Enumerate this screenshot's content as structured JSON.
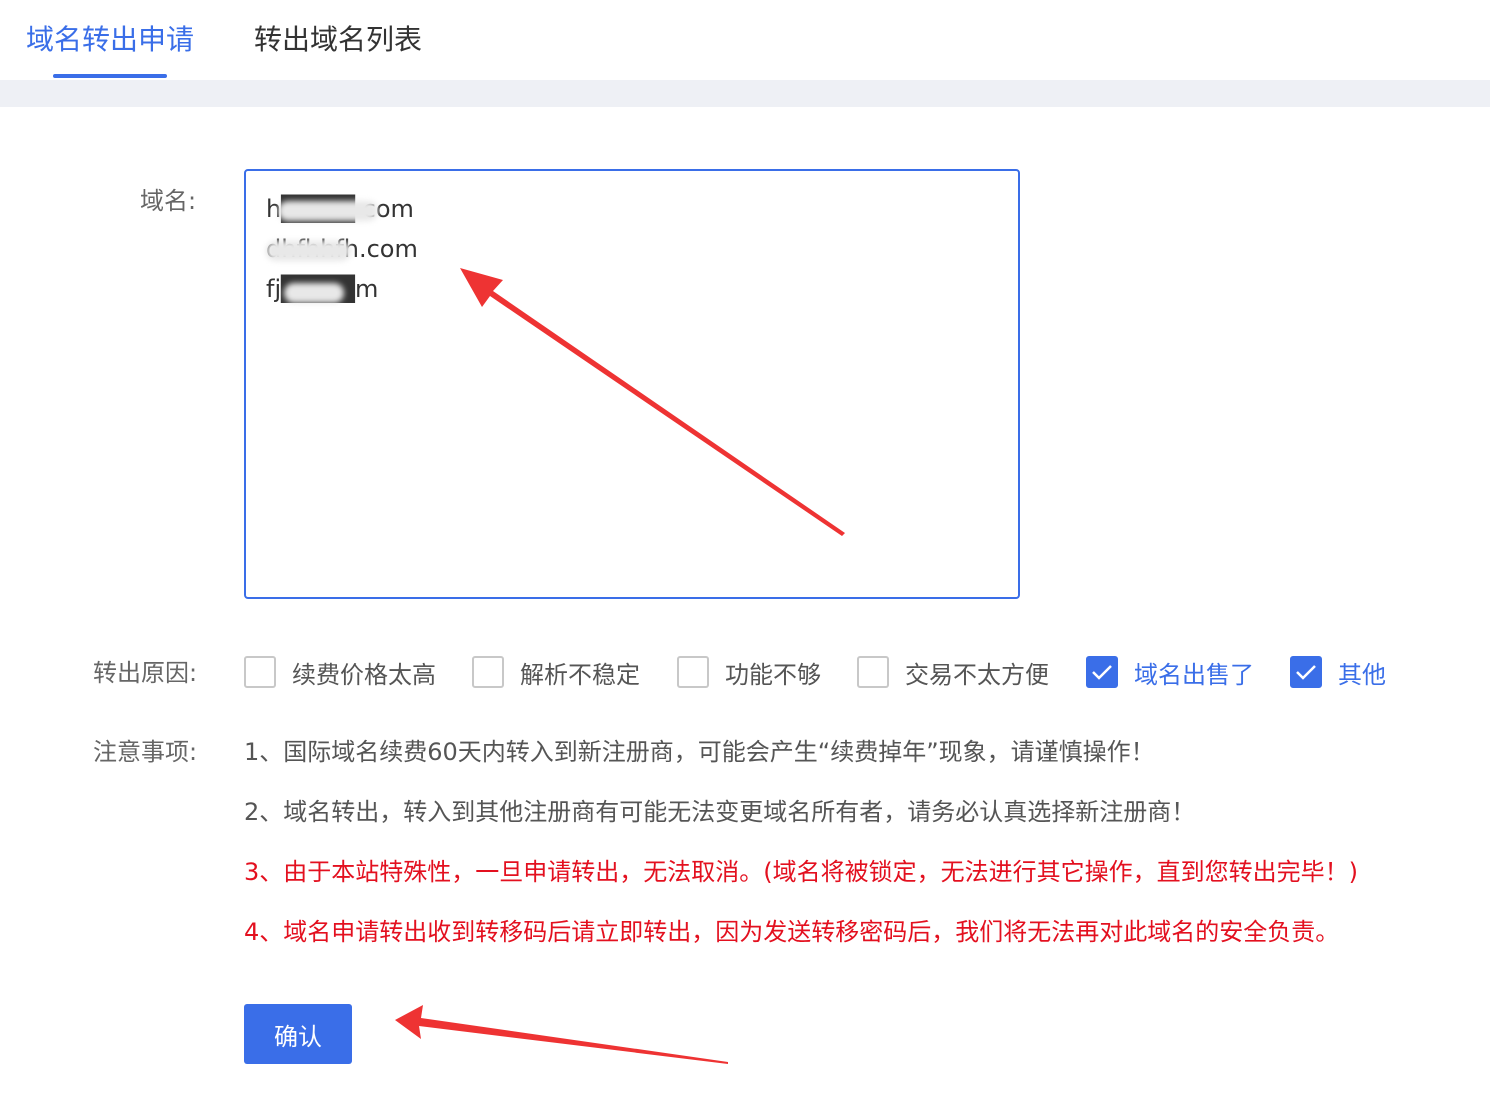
{
  "tabs": [
    {
      "label": "域名转出申请",
      "active": true
    },
    {
      "label": "转出域名列表",
      "active": false
    }
  ],
  "form": {
    "domain_label": "域名:",
    "domains": [
      "h████ com",
      "dhfhhfh.com",
      "fj████m"
    ],
    "reason_label": "转出原因:",
    "reasons": [
      {
        "label": "续费价格太高",
        "checked": false
      },
      {
        "label": "解析不稳定",
        "checked": false
      },
      {
        "label": "功能不够",
        "checked": false
      },
      {
        "label": "交易不太方便",
        "checked": false
      },
      {
        "label": "域名出售了",
        "checked": true
      },
      {
        "label": "其他",
        "checked": true
      }
    ],
    "notes_label": "注意事项:",
    "notes": [
      {
        "text": "1、国际域名续费60天内转入到新注册商，可能会产生“续费掉年”现象，请谨慎操作！",
        "color": "#555555"
      },
      {
        "text": "2、域名转出，转入到其他注册商有可能无法变更域名所有者，请务必认真选择新注册商！",
        "color": "#555555"
      },
      {
        "text": "3、由于本站特殊性，一旦申请转出，无法取消。(域名将被锁定，无法进行其它操作，直到您转出完毕！)",
        "color": "#e3101f"
      },
      {
        "text": "4、域名申请转出收到转移码后请立即转出，因为发送转移密码后，我们将无法再对此域名的安全负责。",
        "color": "#e3101f"
      }
    ],
    "confirm_label": "确认"
  },
  "colors": {
    "accent": "#3a6ee8",
    "warning": "#e3101f",
    "annotation_arrow": "#ee3333"
  }
}
